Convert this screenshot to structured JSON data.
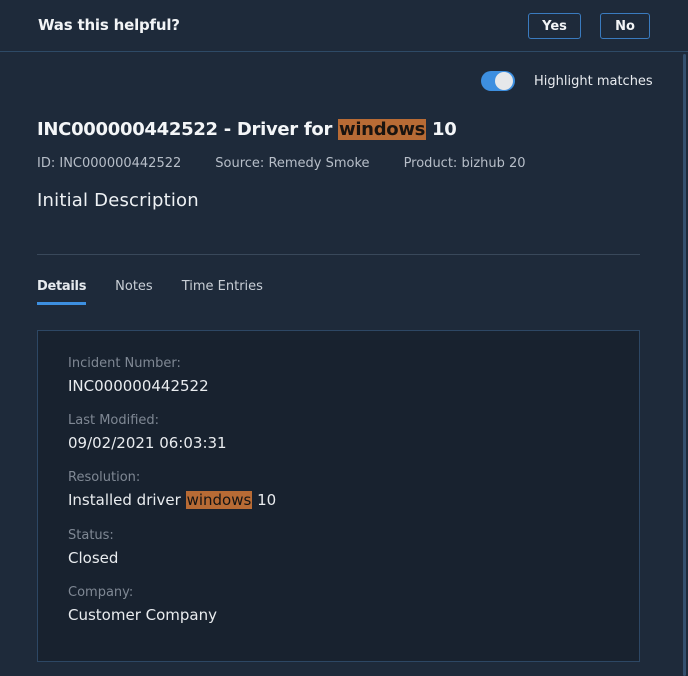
{
  "feedback": {
    "question": "Was this helpful?",
    "yes_label": "Yes",
    "no_label": "No"
  },
  "highlight_toggle": {
    "label": "Highlight matches",
    "enabled": true
  },
  "incident": {
    "title_prefix": "INC000000442522 - Driver for ",
    "title_match": "windows",
    "title_suffix": " 10",
    "meta": {
      "id_label": "ID:",
      "id_value": "INC000000442522",
      "source_label": "Source:",
      "source_value": "Remedy Smoke",
      "product_label": "Product:",
      "product_value": "bizhub 20"
    },
    "section_title": "Initial Description"
  },
  "tabs": [
    {
      "label": "Details",
      "active": true
    },
    {
      "label": "Notes",
      "active": false
    },
    {
      "label": "Time Entries",
      "active": false
    }
  ],
  "details": {
    "incident_number": {
      "label": "Incident Number:",
      "value": "INC000000442522"
    },
    "last_modified": {
      "label": "Last Modified:",
      "value": "09/02/2021 06:03:31"
    },
    "resolution": {
      "label": "Resolution:",
      "value_prefix": "Installed driver ",
      "value_match": "windows",
      "value_suffix": " 10"
    },
    "status": {
      "label": "Status:",
      "value": "Closed"
    },
    "company": {
      "label": "Company:",
      "value": "Customer Company"
    }
  },
  "colors": {
    "accent": "#3d8fe0",
    "highlight": "#b86b35",
    "background": "#1e2a3a",
    "card_background": "#18222f"
  }
}
